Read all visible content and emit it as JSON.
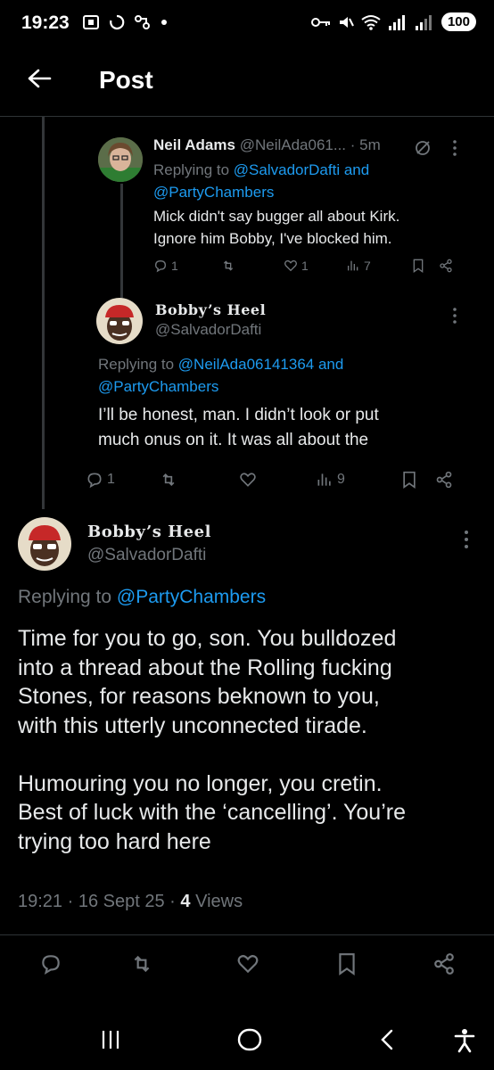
{
  "status_bar": {
    "time": "19:23",
    "battery": "100"
  },
  "header": {
    "title": "Post"
  },
  "reply1": {
    "name": "Neil Adams",
    "handle": "@NeilAda061...",
    "sep": "·",
    "time": "5m",
    "replying_prefix": "Replying to",
    "replying_user1": "@SalvadorDafti",
    "replying_and": "and",
    "replying_user2": "@PartyChambers",
    "line1": "Mick didn't say bugger all about Kirk.",
    "line2": "Ignore him Bobby, I've blocked him.",
    "replies": "1",
    "likes": "1",
    "views": "7"
  },
  "reply2": {
    "name": "Bobby’s Heel",
    "handle": "@SalvadorDafti",
    "replying_prefix": "Replying to",
    "replying_user1": "@NeilAda06141364",
    "replying_and": "and",
    "replying_user2": "@PartyChambers",
    "line1": "I’ll be honest, man. I didn’t look or put",
    "line2": "much onus on it. It was all about the",
    "replies": "1",
    "views": "9"
  },
  "main": {
    "name": "Bobby’s Heel",
    "handle": "@SalvadorDafti",
    "replying_prefix": "Replying to",
    "replying_user": "@PartyChambers",
    "p1_l1": "Time for you to go, son. You bulldozed",
    "p1_l2": "into a thread about the Rolling fucking",
    "p1_l3": "Stones, for reasons beknown to you,",
    "p1_l4": "with this utterly unconnected tirade.",
    "p2_l1": "Humouring you no longer, you cretin.",
    "p2_l2": "Best of luck with the ‘cancelling’. You’re",
    "p2_l3": "trying too hard here",
    "time": "19:21",
    "dot1": "·",
    "date": "16 Sept 25",
    "dot2": "·",
    "views_count": "4",
    "views_label": "Views"
  },
  "colors": {
    "link": "#1d9bf0",
    "muted": "#71767b",
    "text": "#e7e9ea",
    "background": "#000000"
  }
}
